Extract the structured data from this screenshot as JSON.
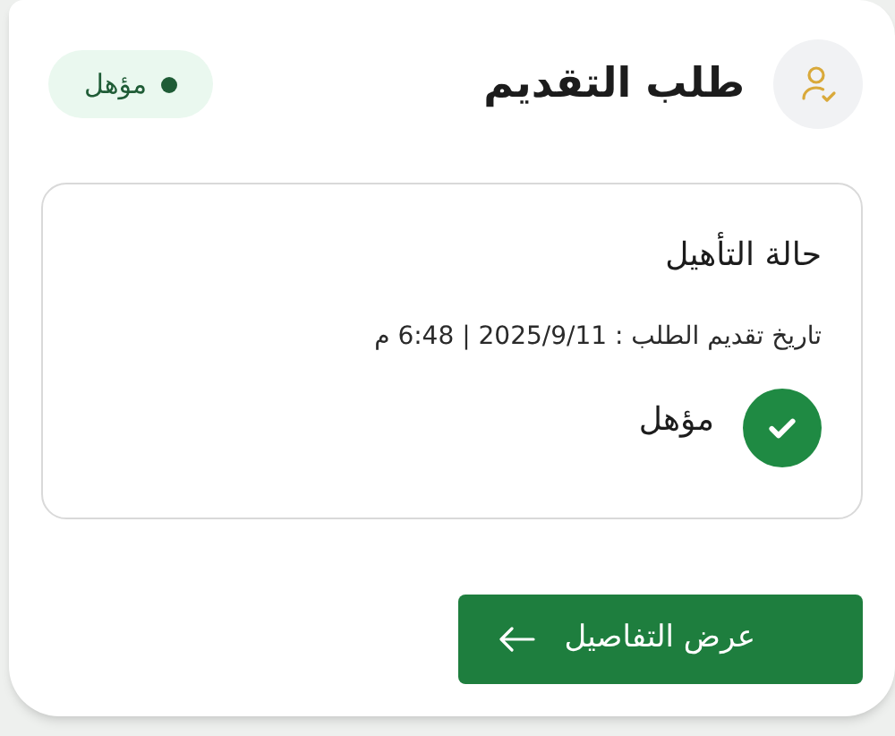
{
  "header": {
    "title": "طلب التقديم",
    "badge": {
      "label": "مؤهل"
    }
  },
  "status_card": {
    "title": "حالة التأهيل",
    "submitted": "تاريخ تقديم الطلب : 2025/9/11 | 6:48 م",
    "status": {
      "label": "مؤهل"
    }
  },
  "details_button": {
    "label": "عرض التفاصيل"
  }
}
